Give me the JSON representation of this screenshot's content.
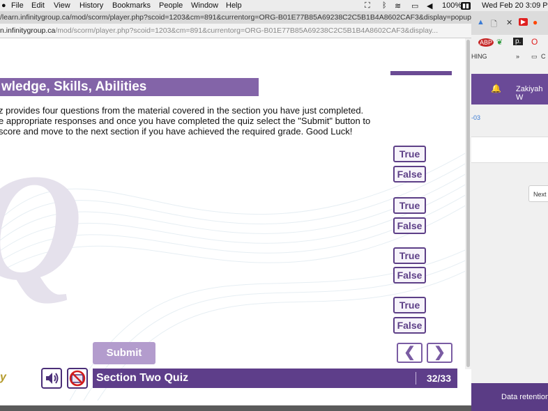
{
  "menubar": {
    "items": [
      "File",
      "Edit",
      "View",
      "History",
      "Bookmarks",
      "People",
      "Window",
      "Help"
    ],
    "battery": "100%",
    "datetime": "Wed Feb 20  3:09 P"
  },
  "browser": {
    "window_url": "/learn.infinitygroup.ca/mod/scorm/player.php?scoid=1203&cm=891&currentorg=ORG-B01E77B85A69238C2C5B1B4A8602CAF3&display=popup&mod...",
    "address_host": "n.infinitygroup.ca",
    "address_path": "/mod/scorm/player.php?scoid=1203&cm=891&currentorg=ORG-B01E77B85A69238C2C5B1B4A8602CAF3&display..."
  },
  "quiz": {
    "title": "wledge, Skills, Abilities",
    "intro": [
      "z provides four questions from the material covered in the section you have just completed.",
      "e appropriate responses and once you have completed the quiz select the \"Submit\" button to",
      " score and move to the next section if you have achieved the required grade. Good Luck!"
    ],
    "questions": [
      {
        "true_label": "True",
        "false_label": "False"
      },
      {
        "true_label": "True",
        "false_label": "False"
      },
      {
        "true_label": "True",
        "false_label": "False"
      },
      {
        "true_label": "True",
        "false_label": "False"
      }
    ],
    "submit_label": "Submit",
    "prev_glyph": "❮",
    "next_glyph": "❯",
    "footer_title": "Section Two Quiz",
    "page_indicator": "32/33",
    "logo_tail": "y"
  },
  "right_pane": {
    "bookmark_text": "HING",
    "bookmark_more": "»",
    "bookmark_folder": "C",
    "user_name": "Zakiyah W",
    "link_fragment": "-03",
    "next_button": "Next",
    "footer_text": "Data retention"
  },
  "colors": {
    "accent_purple": "#5e3e8a",
    "title_purple": "#8364a8",
    "submit_disabled": "#b39ccd"
  }
}
